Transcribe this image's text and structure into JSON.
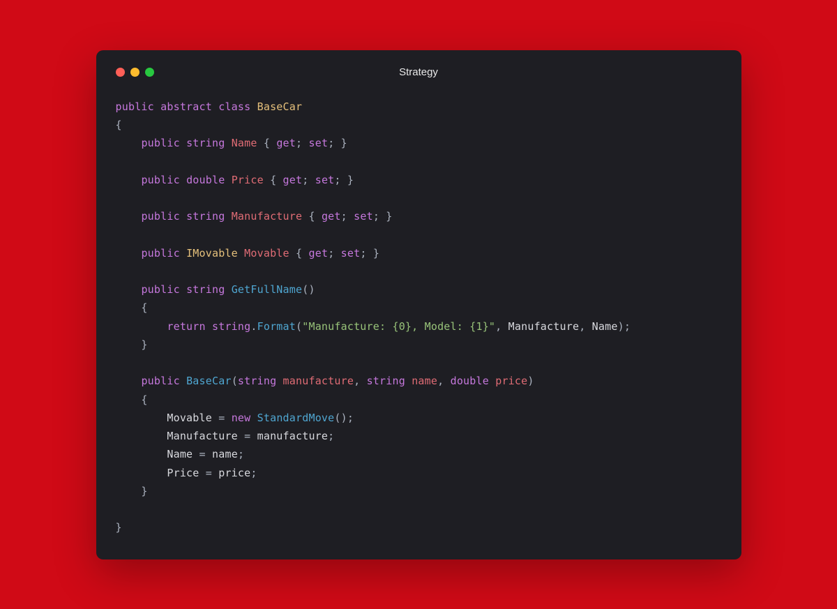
{
  "window": {
    "title": "Strategy"
  },
  "code": {
    "tokens": [
      {
        "t": "keyword",
        "v": "public"
      },
      {
        "t": "punct",
        "v": " "
      },
      {
        "t": "keyword",
        "v": "abstract"
      },
      {
        "t": "punct",
        "v": " "
      },
      {
        "t": "keyword",
        "v": "class"
      },
      {
        "t": "punct",
        "v": " "
      },
      {
        "t": "type",
        "v": "BaseCar"
      },
      {
        "t": "nl"
      },
      {
        "t": "punct",
        "v": "{"
      },
      {
        "t": "nl"
      },
      {
        "t": "punct",
        "v": "    "
      },
      {
        "t": "keyword",
        "v": "public"
      },
      {
        "t": "punct",
        "v": " "
      },
      {
        "t": "keyword",
        "v": "string"
      },
      {
        "t": "punct",
        "v": " "
      },
      {
        "t": "prop",
        "v": "Name"
      },
      {
        "t": "punct",
        "v": " { "
      },
      {
        "t": "keyword",
        "v": "get"
      },
      {
        "t": "punct",
        "v": "; "
      },
      {
        "t": "keyword",
        "v": "set"
      },
      {
        "t": "punct",
        "v": "; }"
      },
      {
        "t": "nl"
      },
      {
        "t": "nl"
      },
      {
        "t": "punct",
        "v": "    "
      },
      {
        "t": "keyword",
        "v": "public"
      },
      {
        "t": "punct",
        "v": " "
      },
      {
        "t": "keyword",
        "v": "double"
      },
      {
        "t": "punct",
        "v": " "
      },
      {
        "t": "prop",
        "v": "Price"
      },
      {
        "t": "punct",
        "v": " { "
      },
      {
        "t": "keyword",
        "v": "get"
      },
      {
        "t": "punct",
        "v": "; "
      },
      {
        "t": "keyword",
        "v": "set"
      },
      {
        "t": "punct",
        "v": "; }"
      },
      {
        "t": "nl"
      },
      {
        "t": "nl"
      },
      {
        "t": "punct",
        "v": "    "
      },
      {
        "t": "keyword",
        "v": "public"
      },
      {
        "t": "punct",
        "v": " "
      },
      {
        "t": "keyword",
        "v": "string"
      },
      {
        "t": "punct",
        "v": " "
      },
      {
        "t": "prop",
        "v": "Manufacture"
      },
      {
        "t": "punct",
        "v": " { "
      },
      {
        "t": "keyword",
        "v": "get"
      },
      {
        "t": "punct",
        "v": "; "
      },
      {
        "t": "keyword",
        "v": "set"
      },
      {
        "t": "punct",
        "v": "; }"
      },
      {
        "t": "nl"
      },
      {
        "t": "nl"
      },
      {
        "t": "punct",
        "v": "    "
      },
      {
        "t": "keyword",
        "v": "public"
      },
      {
        "t": "punct",
        "v": " "
      },
      {
        "t": "type2",
        "v": "IMovable"
      },
      {
        "t": "punct",
        "v": " "
      },
      {
        "t": "prop",
        "v": "Movable"
      },
      {
        "t": "punct",
        "v": " { "
      },
      {
        "t": "keyword",
        "v": "get"
      },
      {
        "t": "punct",
        "v": "; "
      },
      {
        "t": "keyword",
        "v": "set"
      },
      {
        "t": "punct",
        "v": "; }"
      },
      {
        "t": "nl"
      },
      {
        "t": "nl"
      },
      {
        "t": "punct",
        "v": "    "
      },
      {
        "t": "keyword",
        "v": "public"
      },
      {
        "t": "punct",
        "v": " "
      },
      {
        "t": "keyword",
        "v": "string"
      },
      {
        "t": "punct",
        "v": " "
      },
      {
        "t": "method",
        "v": "GetFullName"
      },
      {
        "t": "punct",
        "v": "()"
      },
      {
        "t": "nl"
      },
      {
        "t": "punct",
        "v": "    {"
      },
      {
        "t": "nl"
      },
      {
        "t": "punct",
        "v": "        "
      },
      {
        "t": "keyword",
        "v": "return"
      },
      {
        "t": "punct",
        "v": " "
      },
      {
        "t": "keyword",
        "v": "string"
      },
      {
        "t": "punct",
        "v": "."
      },
      {
        "t": "method",
        "v": "Format"
      },
      {
        "t": "punct",
        "v": "("
      },
      {
        "t": "string",
        "v": "\"Manufacture: {0}, Model: {1}\""
      },
      {
        "t": "punct",
        "v": ", "
      },
      {
        "t": "def",
        "v": "Manufacture"
      },
      {
        "t": "punct",
        "v": ", "
      },
      {
        "t": "def",
        "v": "Name"
      },
      {
        "t": "punct",
        "v": ");"
      },
      {
        "t": "nl"
      },
      {
        "t": "punct",
        "v": "    }"
      },
      {
        "t": "nl"
      },
      {
        "t": "nl"
      },
      {
        "t": "punct",
        "v": "    "
      },
      {
        "t": "keyword",
        "v": "public"
      },
      {
        "t": "punct",
        "v": " "
      },
      {
        "t": "method",
        "v": "BaseCar"
      },
      {
        "t": "punct",
        "v": "("
      },
      {
        "t": "keyword",
        "v": "string"
      },
      {
        "t": "punct",
        "v": " "
      },
      {
        "t": "param",
        "v": "manufacture"
      },
      {
        "t": "punct",
        "v": ", "
      },
      {
        "t": "keyword",
        "v": "string"
      },
      {
        "t": "punct",
        "v": " "
      },
      {
        "t": "param",
        "v": "name"
      },
      {
        "t": "punct",
        "v": ", "
      },
      {
        "t": "keyword",
        "v": "double"
      },
      {
        "t": "punct",
        "v": " "
      },
      {
        "t": "param",
        "v": "price"
      },
      {
        "t": "punct",
        "v": ")"
      },
      {
        "t": "nl"
      },
      {
        "t": "punct",
        "v": "    {"
      },
      {
        "t": "nl"
      },
      {
        "t": "punct",
        "v": "        "
      },
      {
        "t": "def",
        "v": "Movable"
      },
      {
        "t": "punct",
        "v": " = "
      },
      {
        "t": "keyword",
        "v": "new"
      },
      {
        "t": "punct",
        "v": " "
      },
      {
        "t": "method",
        "v": "StandardMove"
      },
      {
        "t": "punct",
        "v": "();"
      },
      {
        "t": "nl"
      },
      {
        "t": "punct",
        "v": "        "
      },
      {
        "t": "def",
        "v": "Manufacture"
      },
      {
        "t": "punct",
        "v": " = "
      },
      {
        "t": "def",
        "v": "manufacture"
      },
      {
        "t": "punct",
        "v": ";"
      },
      {
        "t": "nl"
      },
      {
        "t": "punct",
        "v": "        "
      },
      {
        "t": "def",
        "v": "Name"
      },
      {
        "t": "punct",
        "v": " = "
      },
      {
        "t": "def",
        "v": "name"
      },
      {
        "t": "punct",
        "v": ";"
      },
      {
        "t": "nl"
      },
      {
        "t": "punct",
        "v": "        "
      },
      {
        "t": "def",
        "v": "Price"
      },
      {
        "t": "punct",
        "v": " = "
      },
      {
        "t": "def",
        "v": "price"
      },
      {
        "t": "punct",
        "v": ";"
      },
      {
        "t": "nl"
      },
      {
        "t": "punct",
        "v": "    }"
      },
      {
        "t": "nl"
      },
      {
        "t": "nl"
      },
      {
        "t": "punct",
        "v": "}"
      }
    ]
  }
}
